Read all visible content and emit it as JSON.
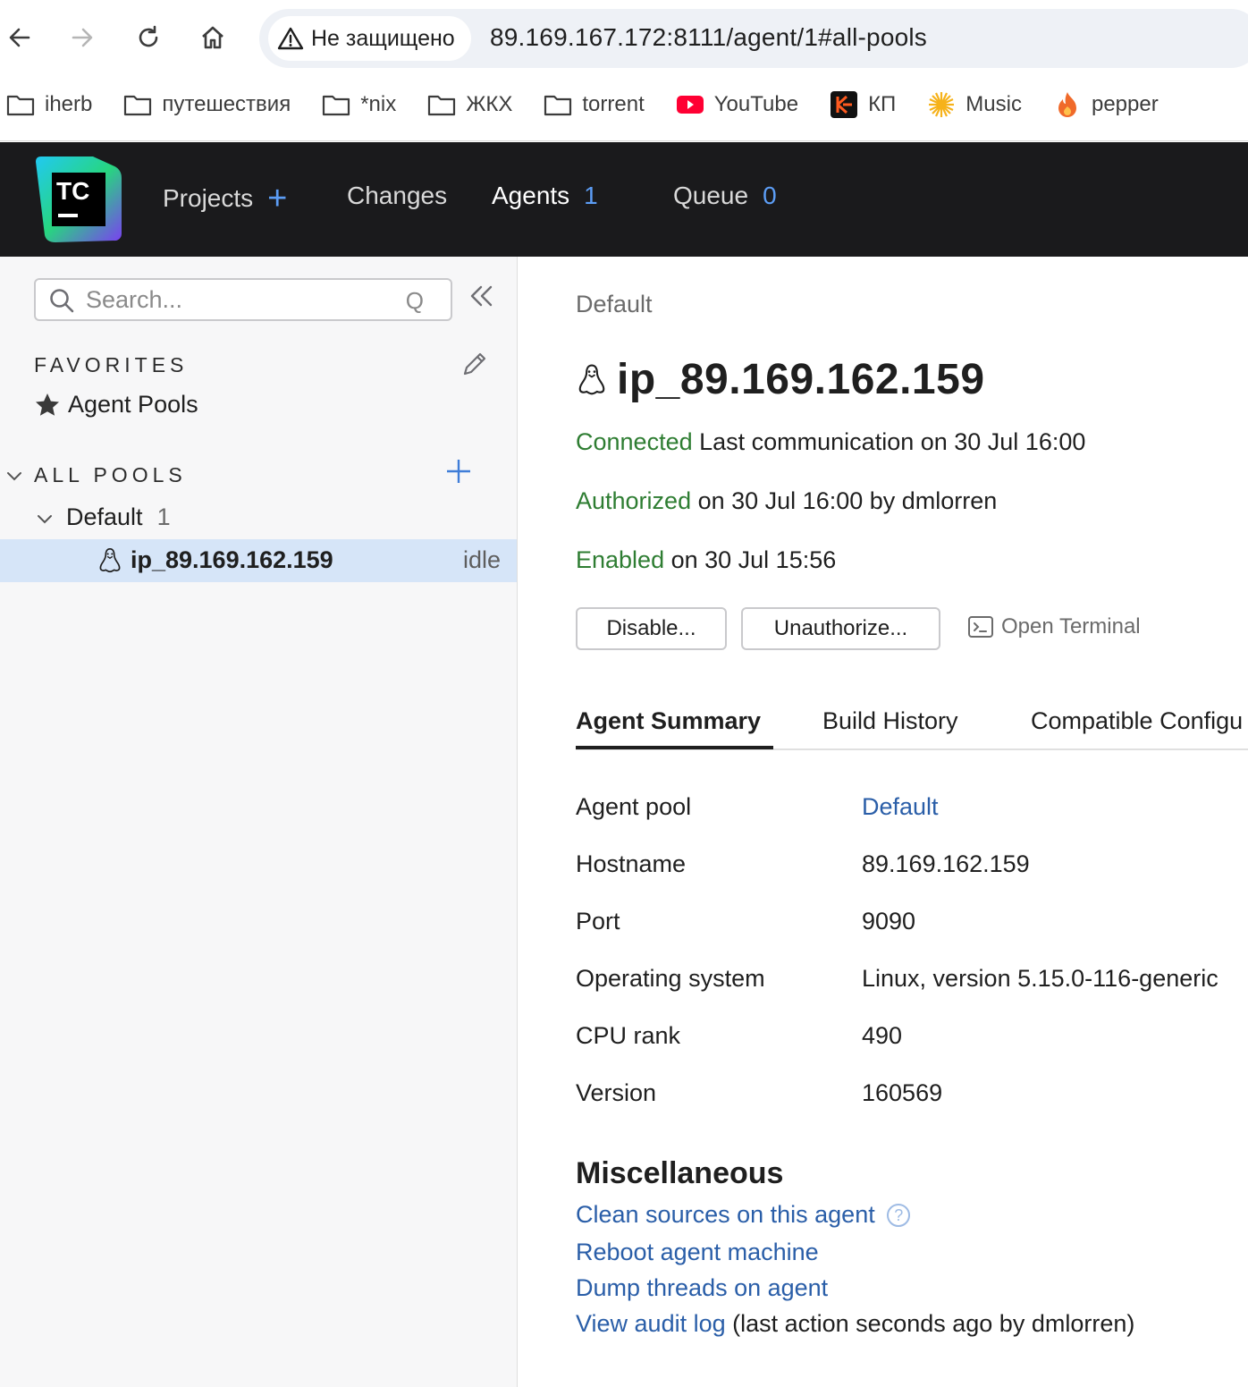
{
  "browser": {
    "security_label": "Не защищено",
    "url": "89.169.167.172:8111/agent/1#all-pools",
    "bookmarks": [
      {
        "label": "iherb",
        "icon": "folder-icon"
      },
      {
        "label": "путешествия",
        "icon": "folder-icon"
      },
      {
        "label": "*nix",
        "icon": "folder-icon"
      },
      {
        "label": "ЖКХ",
        "icon": "folder-icon"
      },
      {
        "label": "torrent",
        "icon": "folder-icon"
      },
      {
        "label": "YouTube",
        "icon": "youtube-icon"
      },
      {
        "label": "КП",
        "icon": "kp-icon"
      },
      {
        "label": "Music",
        "icon": "sun-icon"
      },
      {
        "label": "pepper",
        "icon": "flame-icon"
      }
    ]
  },
  "header": {
    "logo_text": "TC",
    "nav": {
      "projects": "Projects",
      "changes": "Changes",
      "agents": "Agents",
      "agents_count": "1",
      "queue": "Queue",
      "queue_count": "0"
    }
  },
  "sidebar": {
    "search_placeholder": "Search...",
    "search_hotkey": "Q",
    "favorites_title": "FAVORITES",
    "favorites": [
      {
        "label": "Agent Pools",
        "icon": "star-icon"
      }
    ],
    "all_pools_title": "ALL POOLS",
    "pools": [
      {
        "name": "Default",
        "count": "1",
        "agents": [
          {
            "name": "ip_89.169.162.159",
            "status": "idle"
          }
        ]
      }
    ]
  },
  "agent": {
    "breadcrumb": "Default",
    "name": "ip_89.169.162.159",
    "connected_label": "Connected",
    "connected_detail": " Last communication on 30 Jul 16:00",
    "authorized_label": "Authorized",
    "authorized_detail": " on 30 Jul 16:00 by dmlorren",
    "enabled_label": "Enabled",
    "enabled_detail": " on 30 Jul 15:56",
    "buttons": {
      "disable": "Disable...",
      "unauthorize": "Unauthorize...",
      "terminal": "Open Terminal"
    },
    "tabs": [
      "Agent Summary",
      "Build History",
      "Compatible Configu"
    ],
    "summary": [
      {
        "label": "Agent pool",
        "value": "Default"
      },
      {
        "label": "Hostname",
        "value": "89.169.162.159"
      },
      {
        "label": "Port",
        "value": "9090"
      },
      {
        "label": "Operating system",
        "value": "Linux, version 5.15.0-116-generic"
      },
      {
        "label": "CPU rank",
        "value": "490"
      },
      {
        "label": "Version",
        "value": "160569"
      }
    ],
    "misc": {
      "title": "Miscellaneous",
      "clean_sources": "Clean sources on this agent",
      "help": "?",
      "reboot": "Reboot agent machine",
      "dump_threads": "Dump threads on agent",
      "audit_log": "View audit log",
      "audit_note": " (last action seconds ago by dmlorren)"
    }
  },
  "colors": {
    "header_bg": "#1a1a1c",
    "accent_blue": "#5c9df5",
    "link_blue": "#2a5ea8",
    "status_green": "#2e7d32",
    "selected_row": "#d6e5f8"
  }
}
